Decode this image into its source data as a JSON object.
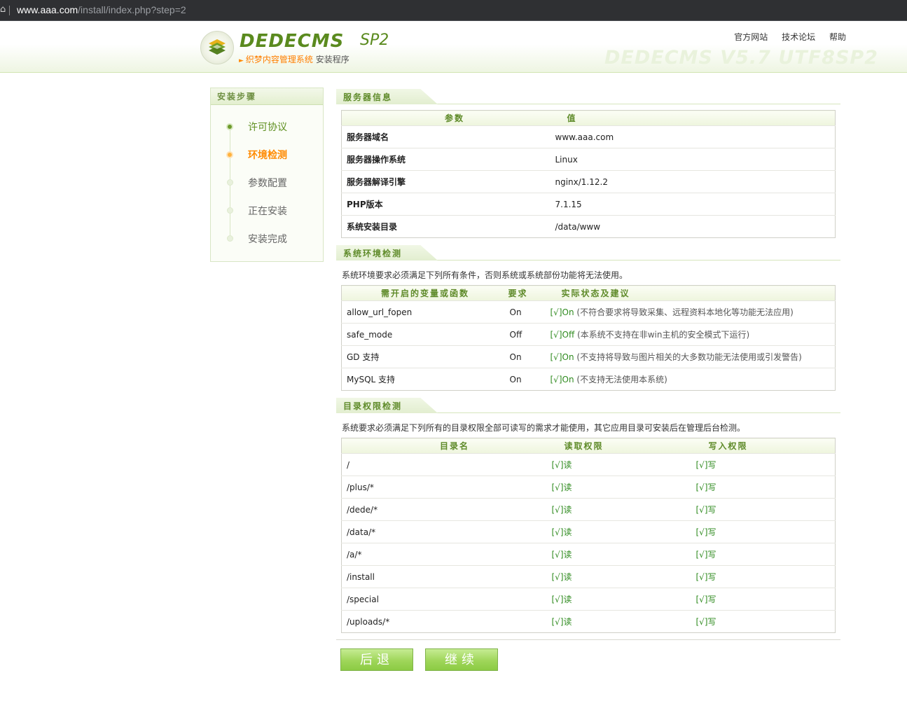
{
  "browser": {
    "url_host": "www.aaa.com",
    "url_path": "/install/index.php?step=2"
  },
  "header": {
    "logo_text": "DEDECMS",
    "logo_version": "SP2",
    "subtitle_orange": "织梦内容管理系统",
    "subtitle_gray": "安装程序",
    "nav": [
      "官方网站",
      "技术论坛",
      "帮助"
    ],
    "watermark": "DEDECMS V5.7 UTF8SP2"
  },
  "sidebar": {
    "title": "安装步骤",
    "steps": [
      {
        "label": "许可协议",
        "state": "done"
      },
      {
        "label": "环境检测",
        "state": "current"
      },
      {
        "label": "参数配置",
        "state": "pending"
      },
      {
        "label": "正在安装",
        "state": "pending"
      },
      {
        "label": "安装完成",
        "state": "pending"
      }
    ]
  },
  "server_info": {
    "title": "服务器信息",
    "headers": [
      "参数",
      "值"
    ],
    "rows": [
      {
        "param": "服务器域名",
        "value": "www.aaa.com"
      },
      {
        "param": "服务器操作系统",
        "value": "Linux"
      },
      {
        "param": "服务器解译引擎",
        "value": "nginx/1.12.2"
      },
      {
        "param": "PHP版本",
        "value": "7.1.15"
      },
      {
        "param": "系统安装目录",
        "value": "/data/www"
      }
    ]
  },
  "env_check": {
    "title": "系统环境检测",
    "note": "系统环境要求必须满足下列所有条件，否则系统或系统部份功能将无法使用。",
    "headers": [
      "需开启的变量或函数",
      "要求",
      "实际状态及建议"
    ],
    "rows": [
      {
        "name": "allow_url_fopen",
        "req": "On",
        "status": "[√]On",
        "msg": "(不符合要求将导致采集、远程资料本地化等功能无法应用)"
      },
      {
        "name": "safe_mode",
        "req": "Off",
        "status": "[√]Off",
        "msg": "(本系统不支持在非win主机的安全模式下运行)"
      },
      {
        "name": "GD 支持",
        "req": "On",
        "status": "[√]On",
        "msg": "(不支持将导致与图片相关的大多数功能无法使用或引发警告)"
      },
      {
        "name": "MySQL 支持",
        "req": "On",
        "status": "[√]On",
        "msg": "(不支持无法使用本系统)"
      }
    ]
  },
  "dir_check": {
    "title": "目录权限检测",
    "note": "系统要求必须满足下列所有的目录权限全部可读写的需求才能使用，其它应用目录可安装后在管理后台检测。",
    "headers": [
      "目录名",
      "读取权限",
      "写入权限"
    ],
    "rows": [
      {
        "dir": "/",
        "read": "[√]读",
        "write": "[√]写"
      },
      {
        "dir": "/plus/*",
        "read": "[√]读",
        "write": "[√]写"
      },
      {
        "dir": "/dede/*",
        "read": "[√]读",
        "write": "[√]写"
      },
      {
        "dir": "/data/*",
        "read": "[√]读",
        "write": "[√]写"
      },
      {
        "dir": "/a/*",
        "read": "[√]读",
        "write": "[√]写"
      },
      {
        "dir": "/install",
        "read": "[√]读",
        "write": "[√]写"
      },
      {
        "dir": "/special",
        "read": "[√]读",
        "write": "[√]写"
      },
      {
        "dir": "/uploads/*",
        "read": "[√]读",
        "write": "[√]写"
      }
    ]
  },
  "buttons": {
    "back": "后退",
    "next": "继续"
  }
}
